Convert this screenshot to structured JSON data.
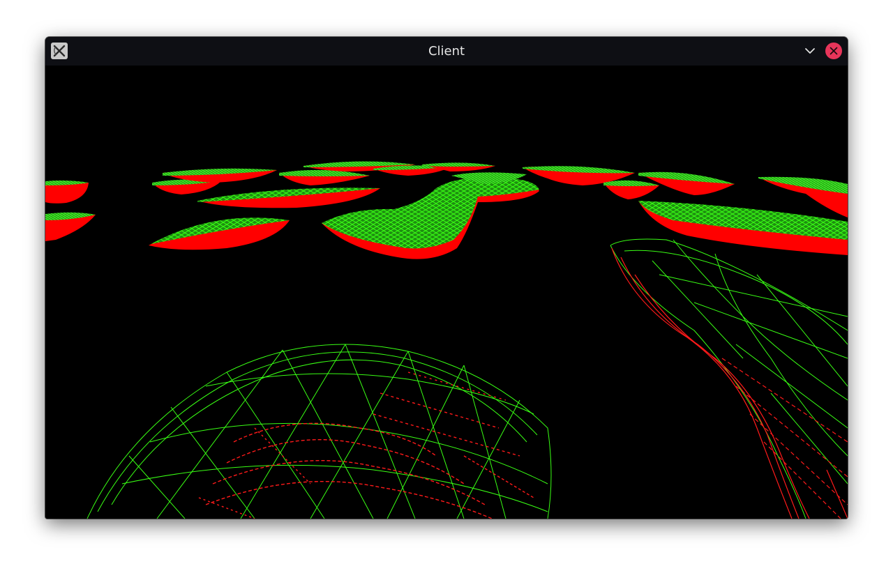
{
  "window": {
    "title": "Client",
    "app_icon": "x-app-icon",
    "controls": {
      "minimize_icon": "chevron-down-icon",
      "close_icon": "close-icon"
    }
  },
  "scene": {
    "background_color": "#000000",
    "wireframe_color": "#39ff14",
    "fill_color": "#ff0000",
    "description_icon": "3d-wireframe-viewport"
  },
  "colors": {
    "titlebar": "#0e0f14",
    "title_text": "#e6e6e6",
    "close_button": "#e8355a"
  }
}
